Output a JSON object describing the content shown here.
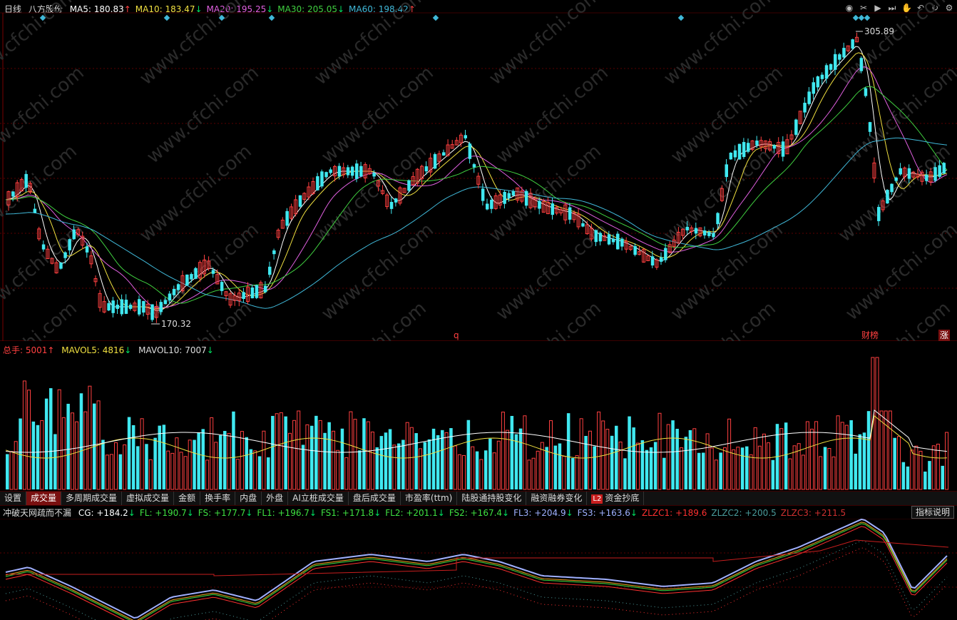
{
  "header": {
    "period": "日线",
    "stock": "八方股份",
    "mas": [
      {
        "label": "MA5: 180.83",
        "arrow": "↑",
        "color": "#ffffff"
      },
      {
        "label": "MA10: 183.47",
        "arrow": "↓",
        "color": "#f0e040"
      },
      {
        "label": "MA20: 195.25",
        "arrow": "↓",
        "color": "#e060e0"
      },
      {
        "label": "MA30: 205.05",
        "arrow": "↓",
        "color": "#40d040"
      },
      {
        "label": "MA60: 198.42",
        "arrow": "↑",
        "color": "#40b8d8"
      }
    ]
  },
  "tools": [
    "eye-icon",
    "scissors-icon",
    "play-icon",
    "next-icon",
    "hand-icon",
    "undo-icon",
    "refresh-icon",
    "settings-icon"
  ],
  "price_chart": {
    "high_label": "305.89",
    "low_label": "170.32",
    "marker_q": "q",
    "marker_report": "财榜",
    "marker_rise": "涨"
  },
  "volume": {
    "label_total": "总手: 5001",
    "total_arrow": "↑",
    "label_mavol5": "MAVOL5: 4816",
    "mavol5_arrow": "↓",
    "label_mavol10": "MAVOL10: 7007",
    "mavol10_arrow": "↓"
  },
  "tabs": [
    {
      "label": "设置",
      "active": false
    },
    {
      "label": "成交量",
      "active": true
    },
    {
      "label": "多周期成交量",
      "active": false
    },
    {
      "label": "虚拟成交量",
      "active": false
    },
    {
      "label": "金额",
      "active": false
    },
    {
      "label": "换手率",
      "active": false
    },
    {
      "label": "内盘",
      "active": false
    },
    {
      "label": "外盘",
      "active": false
    },
    {
      "label": "AI立桩成交量",
      "active": false
    },
    {
      "label": "盘后成交量",
      "active": false
    },
    {
      "label": "市盈率(ttm)",
      "active": false
    },
    {
      "label": "陆股通持股变化",
      "active": false
    },
    {
      "label": "融资融券变化",
      "active": false
    },
    {
      "label": "资金抄底",
      "active": false,
      "badge": "L2"
    }
  ],
  "indicator": {
    "name": "冲破天网疏而不漏",
    "items": [
      {
        "label": "CG: +184.2",
        "arrow": "↓",
        "color": "#ffffff"
      },
      {
        "label": "FL: +190.7",
        "arrow": "↓",
        "color": "#40e040"
      },
      {
        "label": "FS: +177.7",
        "arrow": "↓",
        "color": "#40e040"
      },
      {
        "label": "FL1: +196.7",
        "arrow": "↓",
        "color": "#40e040"
      },
      {
        "label": "FS1: +171.8",
        "arrow": "↓",
        "color": "#40e040"
      },
      {
        "label": "FL2: +201.1",
        "arrow": "↓",
        "color": "#40e040"
      },
      {
        "label": "FS2: +167.4",
        "arrow": "↓",
        "color": "#40e040"
      },
      {
        "label": "FL3: +204.9",
        "arrow": "↓",
        "color": "#a0b0ff"
      },
      {
        "label": "FS3: +163.6",
        "arrow": "↓",
        "color": "#a0b0ff"
      },
      {
        "label": "ZLZC1: +189.6",
        "arrow": "",
        "color": "#ff3030"
      },
      {
        "label": "ZLZC2: +200.5",
        "arrow": "",
        "color": "#4a9a9a"
      },
      {
        "label": "ZLZC3: +211.5",
        "arrow": "",
        "color": "#d03030"
      }
    ],
    "explain": "指标说明"
  },
  "watermark": "www.cfchi.com"
}
